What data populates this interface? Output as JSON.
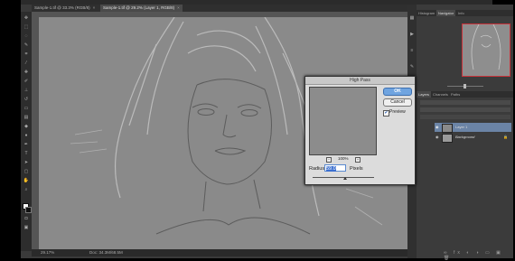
{
  "tabs": [
    {
      "label": "Sample-1.tif @ 33.3% (RGB/8)",
      "close": "×"
    },
    {
      "label": "Sample-1.tif @ 29.2% (Layer 1, RGB/8)",
      "close": "×"
    }
  ],
  "status": {
    "zoom": "29.17%",
    "doc": "Doc: 34.3M/68.5M"
  },
  "panel_tabs_top": [
    "Histogram",
    "Navigator",
    "Info"
  ],
  "panel_tabs_layers": [
    "Layers",
    "Channels",
    "Paths"
  ],
  "layers": [
    {
      "name": "Layer 1",
      "selected": true
    },
    {
      "name": "Background",
      "selected": false
    }
  ],
  "dialog": {
    "title": "High Pass",
    "ok_label": "OK",
    "cancel_label": "Cancel",
    "preview_label": "Preview",
    "preview_checked": "✔",
    "zoom_out": "−",
    "zoom_in": "+",
    "zoom_level": "100%",
    "radius_label": "Radius:",
    "radius_value": "59.0",
    "radius_unit": "Pixels"
  },
  "colors": {
    "accent": "#6fa4e0",
    "selected_layer": "#6b84a6",
    "nav_box": "#c8323a"
  }
}
